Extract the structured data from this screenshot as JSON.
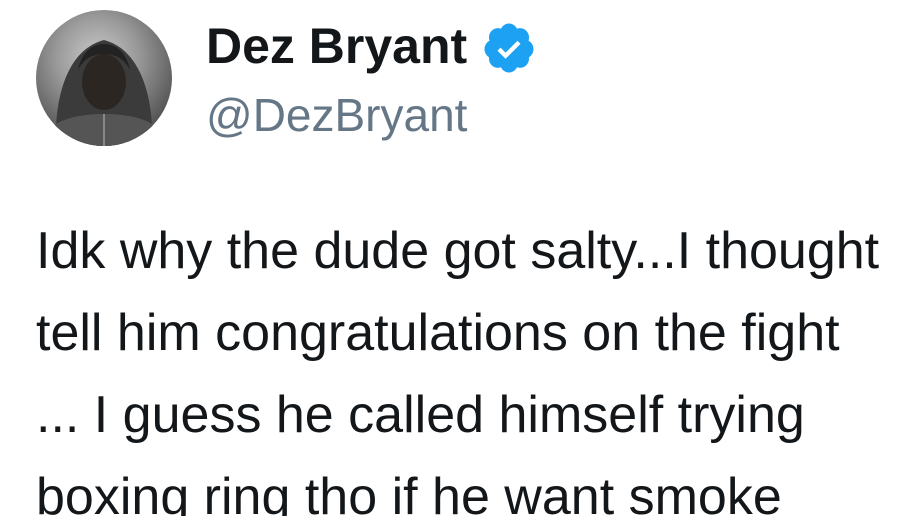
{
  "tweet": {
    "display_name": "Dez Bryant",
    "handle": "@DezBryant",
    "verified": true,
    "avatar_icon": "profile-photo",
    "body_lines": [
      "Idk why the dude got salty...I thought",
      "tell him congratulations on the fight",
      "... I guess he called himself trying",
      "boxing ring tho if he want smoke"
    ]
  },
  "colors": {
    "name": "#14171a",
    "handle": "#657786",
    "verified_blue": "#1da1f2",
    "text": "#14171a"
  }
}
